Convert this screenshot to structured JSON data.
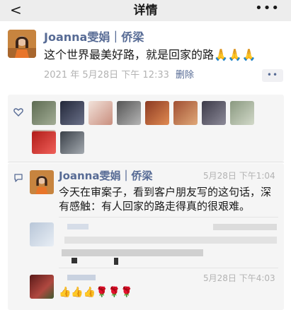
{
  "navbar": {
    "back_glyph": "<",
    "title": "详情",
    "more_glyph": "•••"
  },
  "post": {
    "author": "Joanna雯娟｜侨梁",
    "text": "这个世界最美好路，就是回家的路🙏🙏🙏",
    "time": "2021 年 5月28日 下午 12:33",
    "delete_label": "删除",
    "more_glyph": "••"
  },
  "likes": {
    "icon": "heart-outline-icon",
    "avatar_colors": [
      "#7d8a72",
      "#3b3f52",
      "#d9b5a5",
      "#8a8a8a",
      "#c45a3a",
      "#c07a55",
      "#5c5a68",
      "#a6b09a",
      "#c9b4a8",
      "#c8302a",
      "#66707a"
    ]
  },
  "comments": [
    {
      "author": "Joanna雯娟｜侨梁",
      "time": "5月28日 下午1:04",
      "text": "今天在审案子，看到客户朋友写的这句话，深有感触：有人回家的路走得真的很艰难。"
    },
    {
      "author": "",
      "time": "",
      "text": ""
    },
    {
      "author": "",
      "time": "5月28日 下午4:03",
      "text": "👍👍👍🌹🌹🌹"
    }
  ],
  "comment_icon": "chat-bubble-icon",
  "colors": {
    "link_blue": "#576b95",
    "gray_text": "#b2b2b2",
    "panel_bg": "#f5f5f5"
  }
}
